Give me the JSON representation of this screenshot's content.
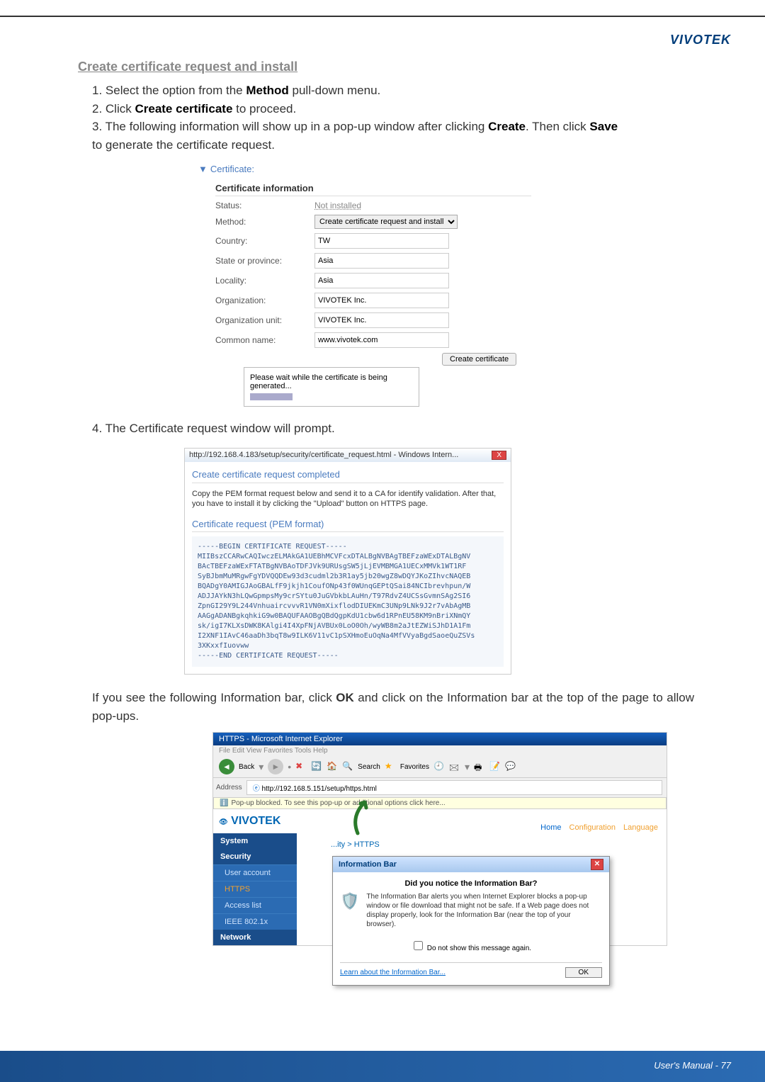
{
  "brand": "VIVOTEK",
  "sectionTitle": "Create certificate request and install",
  "steps": {
    "s1a": "1. Select the option from the ",
    "s1b": "Method",
    "s1c": " pull-down menu.",
    "s2a": "2. Click ",
    "s2b": "Create certificate",
    "s2c": " to proceed.",
    "s3a": "3. The following information will show up in a pop-up window after clicking ",
    "s3b": "Create",
    "s3c": ". Then click ",
    "s3d": "Save",
    "s3e": "   to generate the certificate request."
  },
  "fig1": {
    "head": "Certificate:",
    "sub": "Certificate information",
    "labels": {
      "status": "Status:",
      "method": "Method:",
      "country": "Country:",
      "state": "State or province:",
      "locality": "Locality:",
      "org": "Organization:",
      "orgunit": "Organization unit:",
      "common": "Common name:"
    },
    "values": {
      "status": "Not installed",
      "method": "Create certificate request and install",
      "country": "TW",
      "state": "Asia",
      "locality": "Asia",
      "org": "VIVOTEK Inc.",
      "orgunit": "VIVOTEK Inc.",
      "common": "www.vivotek.com"
    },
    "btn": "Create certificate",
    "wait": "Please wait while the certificate is being generated..."
  },
  "step4": "4. The Certificate request window will prompt.",
  "fig2": {
    "title": "http://192.168.4.183/setup/security/certificate_request.html - Windows Intern...",
    "h1": "Create certificate request completed",
    "p1": "Copy the PEM format request below and send it to a CA for identify validation. After that, you have to install it by clicking the \"Upload\" button on HTTPS page.",
    "h2": "Certificate request (PEM format)",
    "pem": "-----BEGIN CERTIFICATE REQUEST-----\nMIIBszCCARwCAQIwczELMAkGA1UEBhMCVFcxDTALBgNVBAgTBEFzaWExDTALBgNV\nBAcTBEFzaWExFTATBgNVBAoTDFJVk9URUsgSW5jLjEVMBMGA1UECxMMVk1WT1RF\nSyBJbmMuMRgwFgYDVQQDEw93d3cudml2b3R1ay5jb20wgZ8wDQYJKoZIhvcNAQEB\nBQADgY0AMIGJAoGBALfF9jkjh1CoufONp43f0WUnqGEPtQSai84NCIbrevhpun/W\nADJJAYkN3hLQwGpmpsMy9crSYtu0JuGVbkbLAuHn/T97RdvZ4UCSsGvmnSAg2SI6\nZpnGI29Y9L244VnhuaircvvvR1VN0mXixflodDIUEKmC3UNp9LNk9J2r7vAbAgMB\nAAGgADANBgkqhkiG9w0BAQUFAAOBgQBdQgpKdU1cbw6d1RPnEU58KM9nBriXNmQY\nsk/igI7KLXsDWK8KAlgi4I4XpFNjAVBUx0LoO0Oh/wyWB8m2aJtEZWiSJhD1A1Fm\nI2XNF1IAvC46aaDh3bqT8w9ILK6V11vC1pSXHmoEuOqNa4MfVVyaBgdSaoeQuZSVs\n3XKxxfIuovww\n-----END CERTIFICATE REQUEST-----"
  },
  "para2a": "If you see the following Information bar, click ",
  "para2b": "OK",
  "para2c": " and click on the Information bar at the top of the page to allow pop-ups.",
  "fig3": {
    "ieTitle": "HTTPS - Microsoft Internet Explorer",
    "ieMenu": "File   Edit   View   Favorites   Tools   Help",
    "backTxt": "Back",
    "searchTxt": "Search",
    "favTxt": "Favorites",
    "addrLabel": "Address",
    "addr": "http://192.168.5.151/setup/https.html",
    "popupBar": "Pop-up blocked. To see this pop-up or additional options click here...",
    "logo": "VIVOTEK",
    "breadcrumb": "...ity > HTTPS",
    "links": {
      "home": "Home",
      "conf": "Configuration",
      "lang": "Language"
    },
    "menu": {
      "system": "System",
      "security": "Security",
      "user": "User account",
      "https": "HTTPS",
      "access": "Access list",
      "ieee": "IEEE 802.1x",
      "network": "Network"
    },
    "dialog": {
      "title": "Information Bar",
      "q": "Did you notice the Information Bar?",
      "body": "The Information Bar alerts you when Internet Explorer blocks a pop-up window or file download that might not be safe. If a Web page does not display properly, look for the Information Bar (near the top of your browser).",
      "chk": "Do not show this message again.",
      "learn": "Learn about the Information Bar...",
      "ok": "OK"
    }
  },
  "footer": "User's Manual - 77"
}
